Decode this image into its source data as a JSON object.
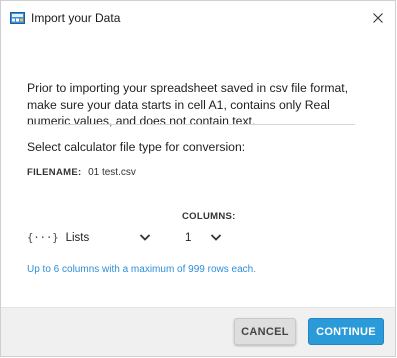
{
  "window": {
    "title": "Import your Data",
    "app_icon": "calculator-app-icon",
    "close_icon": "close-icon"
  },
  "intro_text": "Prior to importing your spreadsheet saved in csv file format, make sure your data starts in cell A1, contains only Real numeric values, and does not contain text.",
  "file_type_prompt": "Select calculator file type for conversion:",
  "filename": {
    "label": "FILENAME:",
    "value": "01 test.csv"
  },
  "type_select": {
    "glyph": "{···}",
    "value": "Lists",
    "icon": "chevron-down-icon"
  },
  "columns": {
    "label": "COLUMNS:",
    "value": "1",
    "icon": "chevron-down-icon"
  },
  "hint": "Up to 6 columns with a maximum of 999 rows each.",
  "buttons": {
    "cancel": "CANCEL",
    "continue": "CONTINUE"
  },
  "colors": {
    "accent": "#2b9ad9",
    "hint_text": "#2f8fd8",
    "footer_bg": "#f0f0f0"
  }
}
